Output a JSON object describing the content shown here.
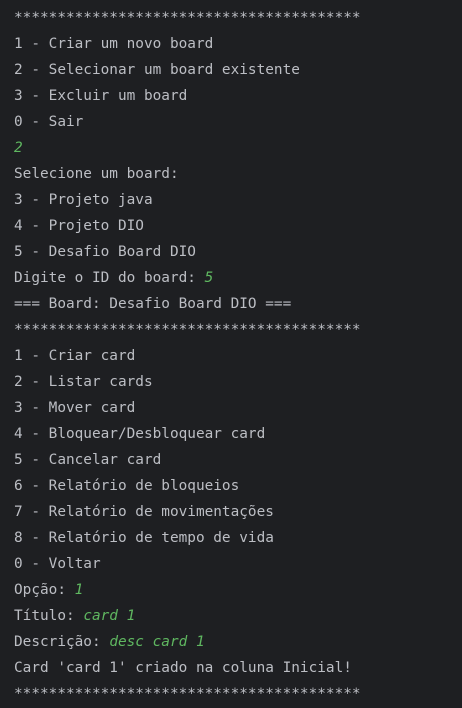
{
  "colors": {
    "background": "#1e1f22",
    "text": "#bcbec4",
    "user_input": "#5fb760"
  },
  "console": {
    "separator": "****************************************",
    "main_menu": [
      "1 - Criar um novo board",
      "2 - Selecionar um board existente",
      "3 - Excluir um board",
      "0 - Sair"
    ],
    "main_choice": "2",
    "select_prompt": "Selecione um board:",
    "boards": [
      "3 - Projeto java",
      "4 - Projeto DIO",
      "5 - Desafio Board DIO"
    ],
    "id_prompt": "Digite o ID do board: ",
    "id_value": "5",
    "board_header": "=== Board: Desafio Board DIO ===",
    "board_menu": [
      "1 - Criar card",
      "2 - Listar cards",
      "3 - Mover card",
      "4 - Bloquear/Desbloquear card",
      "5 - Cancelar card",
      "6 - Relatório de bloqueios",
      "7 - Relatório de movimentações",
      "8 - Relatório de tempo de vida",
      "0 - Voltar"
    ],
    "option_prompt": "Opção: ",
    "option_value": "1",
    "title_prompt": "Título: ",
    "title_value": "card 1",
    "desc_prompt": "Descrição: ",
    "desc_value": "desc card 1",
    "result_message": "Card 'card 1' criado na coluna Inicial!"
  }
}
